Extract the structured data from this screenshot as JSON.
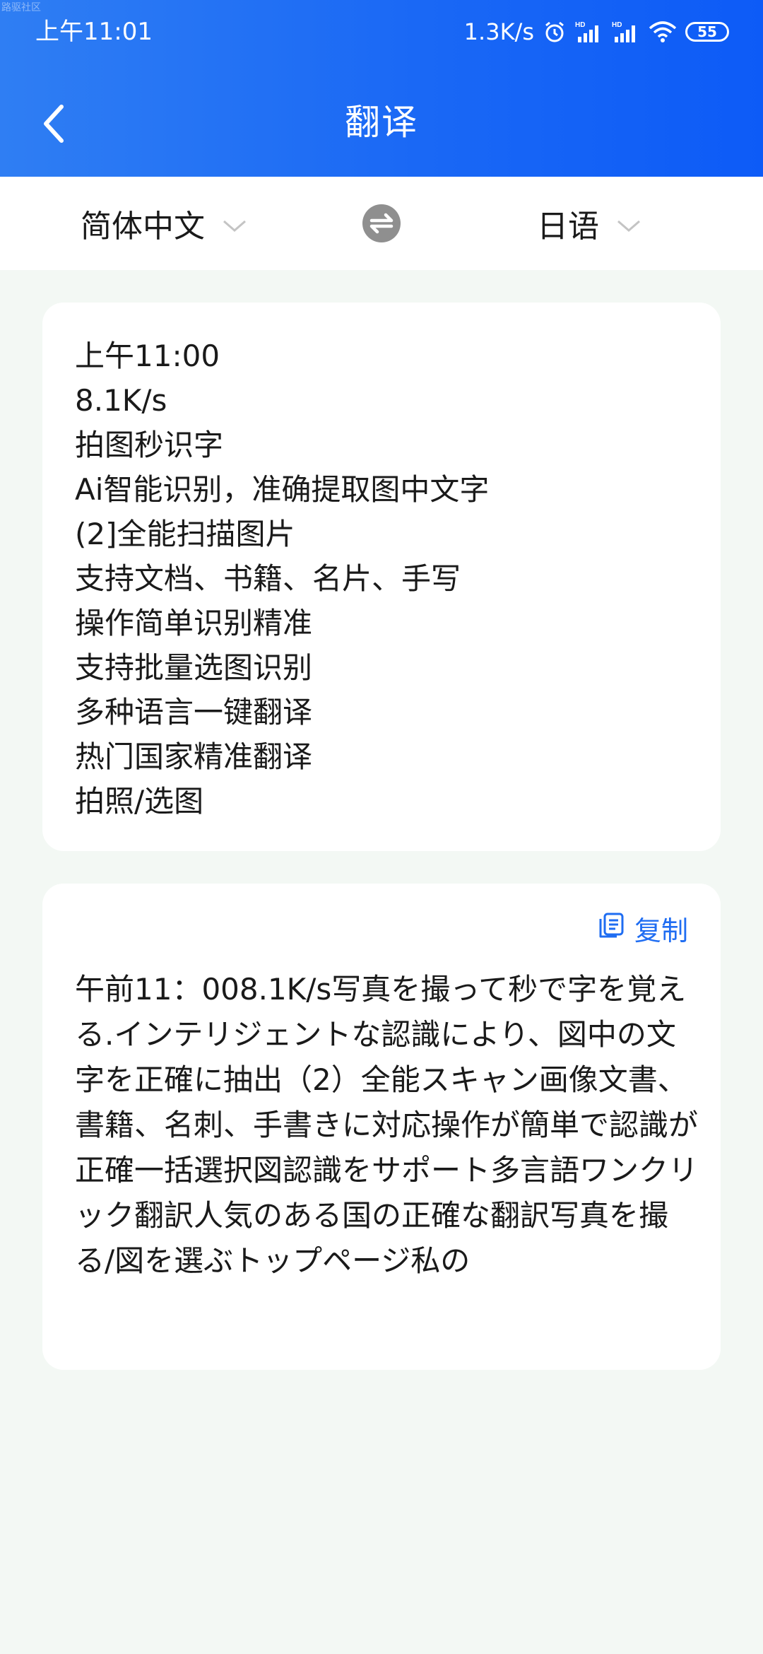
{
  "watermark": "路驱社区",
  "status_bar": {
    "time": "上午11:01",
    "network_speed": "1.3K/s",
    "battery": "55",
    "icons": [
      "alarm-icon",
      "signal-hd-icon",
      "signal-hd-icon",
      "wifi-icon",
      "battery-icon"
    ]
  },
  "header": {
    "title": "翻译",
    "back_icon": "chevron-left-icon",
    "colors": {
      "start": "#2f7ef3",
      "end": "#0d5bf7"
    }
  },
  "language_bar": {
    "source_language": "简体中文",
    "target_language": "日语",
    "swap_icon": "swap-icon",
    "dropdown_icon": "chevron-down-icon"
  },
  "source_text": {
    "lines": [
      "上午11:00",
      "8.1K/s",
      "拍图秒识字",
      "Ai智能识别，准确提取图中文字",
      "(2]全能扫描图片",
      "支持文档、书籍、名片、手写",
      "操作简单识别精准",
      "支持批量选图识别",
      "多种语言一键翻译",
      "热门国家精准翻译",
      "拍照/选图"
    ]
  },
  "result": {
    "copy_label": "复制",
    "copy_icon": "copy-icon",
    "text": "午前11：008.1K/s写真を撮って秒で字を覚える.インテリジェントな認識により、図中の文字を正確に抽出（2）全能スキャン画像文書、書籍、名刺、手書きに対応操作が簡単で認識が正確一括選択図認識をサポート多言語ワンクリック翻訳人気のある国の正確な翻訳写真を撮る/図を選ぶトップページ私の"
  },
  "colors": {
    "accent": "#1f6df2",
    "background": "#f3f8f4",
    "card": "#ffffff"
  }
}
